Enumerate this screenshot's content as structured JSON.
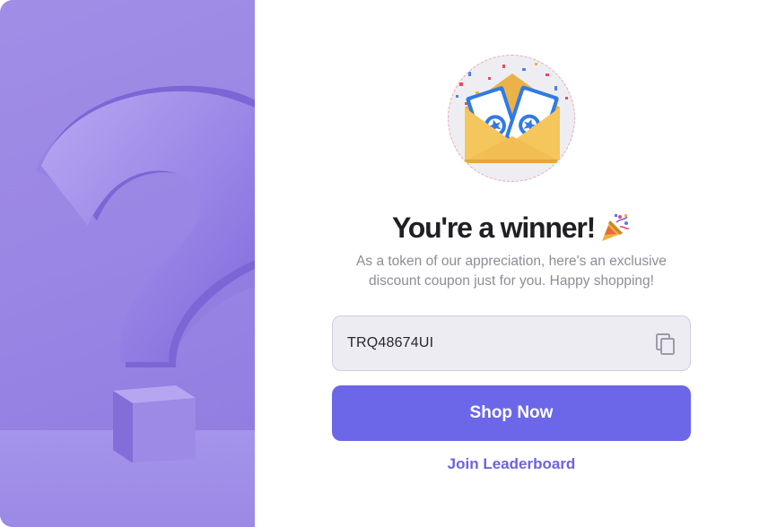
{
  "popup": {
    "title": "You're a winner!",
    "title_emoji_icon": "party-popper-icon",
    "subtitle": "As a token of our appreciation, here's an exclusive discount coupon just for you. Happy shopping!",
    "coupon_code": "TRQ48674UI",
    "copy_icon": "copy-icon",
    "primary_button": "Shop Now",
    "secondary_link": "Join Leaderboard"
  },
  "colors": {
    "accent": "#6c67e8",
    "link": "#6d63e0",
    "hero_background": "#9a86e4",
    "title": "#1f1f24",
    "subtitle": "#8d8d98"
  }
}
